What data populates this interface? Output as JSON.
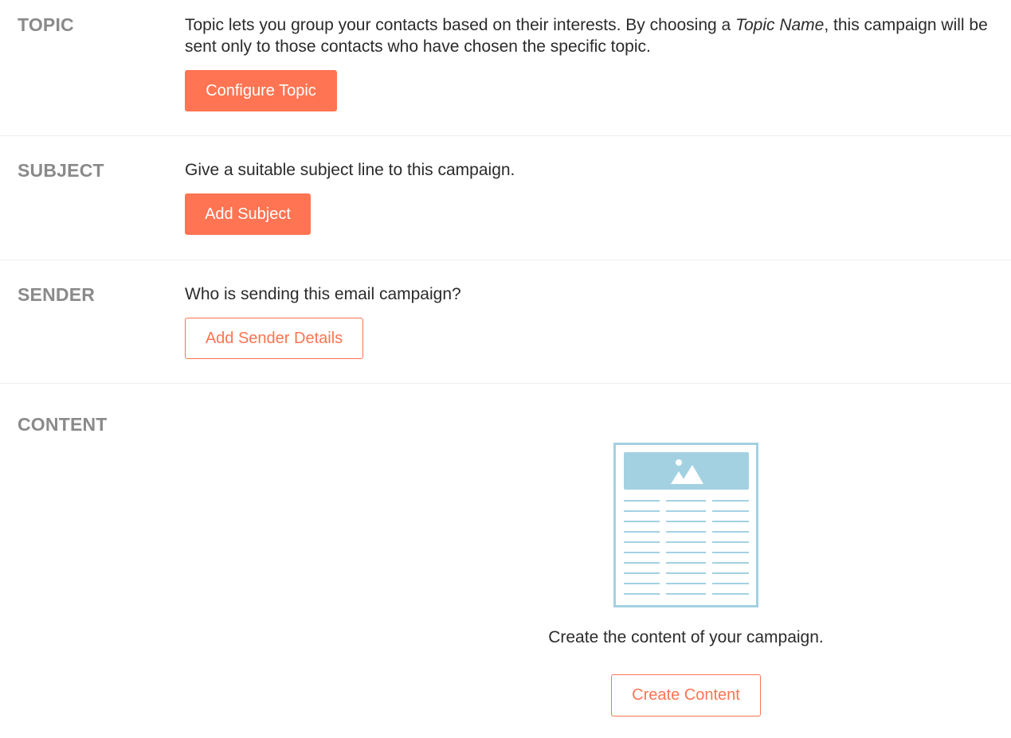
{
  "topic": {
    "label": "TOPIC",
    "desc_before": "Topic lets you group your contacts based on their interests. By choosing a ",
    "desc_italic": "Topic Name",
    "desc_after": ", this campaign will be sent only to those contacts who have chosen the specific topic.",
    "button_label": "Configure Topic"
  },
  "subject": {
    "label": "SUBJECT",
    "desc": "Give a suitable subject line to this campaign.",
    "button_label": "Add Subject"
  },
  "sender": {
    "label": "SENDER",
    "desc": "Who is sending this email campaign?",
    "button_label": "Add Sender Details"
  },
  "content": {
    "label": "CONTENT",
    "illustration_icon": "email-template-icon",
    "desc": "Create the content of your campaign.",
    "button_label": "Create Content"
  },
  "colors": {
    "accent": "#ff7452",
    "label_gray": "#8a8a8a",
    "illustration_blue": "#a3d1e2"
  }
}
